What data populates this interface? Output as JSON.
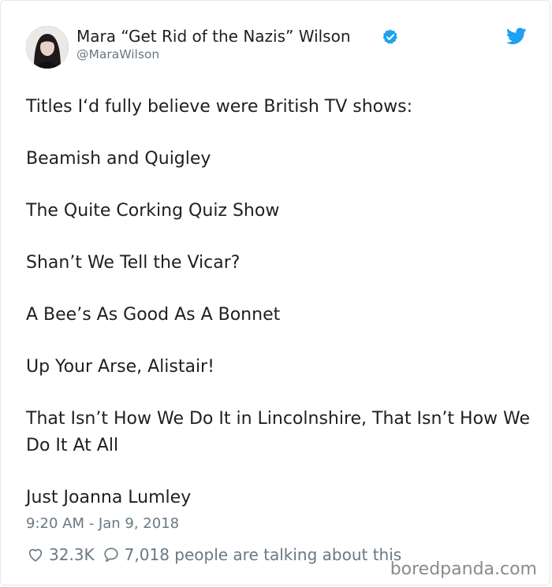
{
  "tweet": {
    "author_name": "Mara “Get Rid of the Nazis” Wilson",
    "handle": "@MaraWilson",
    "paragraphs": [
      "Titles I‘d fully believe were British TV shows:",
      "Beamish and Quigley",
      "The Quite Corking Quiz Show",
      "Shan’t We Tell the Vicar?",
      "A Bee’s As Good As A Bonnet",
      "Up Your Arse, Alistair!",
      "That Isn’t How We Do It in Lincolnshire, That Isn’t How We Do It At All",
      "Just Joanna Lumley"
    ],
    "timestamp": "9:20 AM - Jan 9, 2018",
    "likes": "32.3K",
    "talking": "7,018 people are talking about this"
  },
  "icons": {
    "verified": "verified-badge-icon",
    "brand": "twitter-bird-icon",
    "like": "heart-icon",
    "reply": "speech-bubble-icon"
  },
  "colors": {
    "verified_blue": "#1da1f2",
    "twitter_blue": "#1da1f2",
    "muted_text": "#697882"
  },
  "watermark": "boredpanda.com"
}
